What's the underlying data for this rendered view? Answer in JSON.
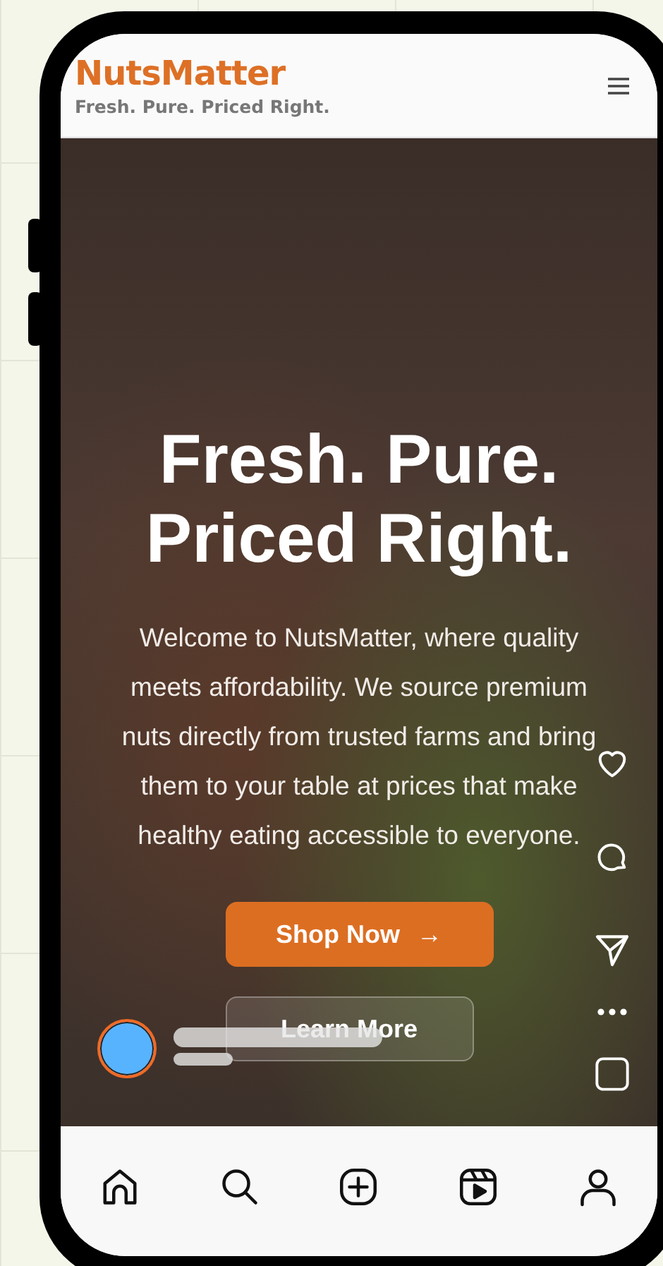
{
  "brand": {
    "name": "NutsMatter",
    "tagline": "Fresh. Pure. Priced Right."
  },
  "hero": {
    "title_lines": [
      "Fresh. Pure.",
      "Priced Right."
    ],
    "description": "Welcome to NutsMatter, where quality meets affordability. We source premium nuts directly from trusted farms and bring them to your table at prices that make healthy eating accessible to everyone.",
    "buttons": [
      {
        "label": "Shop Now",
        "kind": "primary",
        "arrow": "→"
      },
      {
        "label": "Learn More",
        "kind": "secondary"
      }
    ]
  },
  "reel_actions": [
    {
      "kind": "heart"
    },
    {
      "kind": "comment"
    },
    {
      "kind": "send"
    },
    {
      "kind": "more"
    },
    {
      "kind": "square"
    }
  ],
  "bottom_nav": [
    {
      "kind": "home"
    },
    {
      "kind": "search"
    },
    {
      "kind": "create"
    },
    {
      "kind": "reels"
    },
    {
      "kind": "profile"
    }
  ]
}
